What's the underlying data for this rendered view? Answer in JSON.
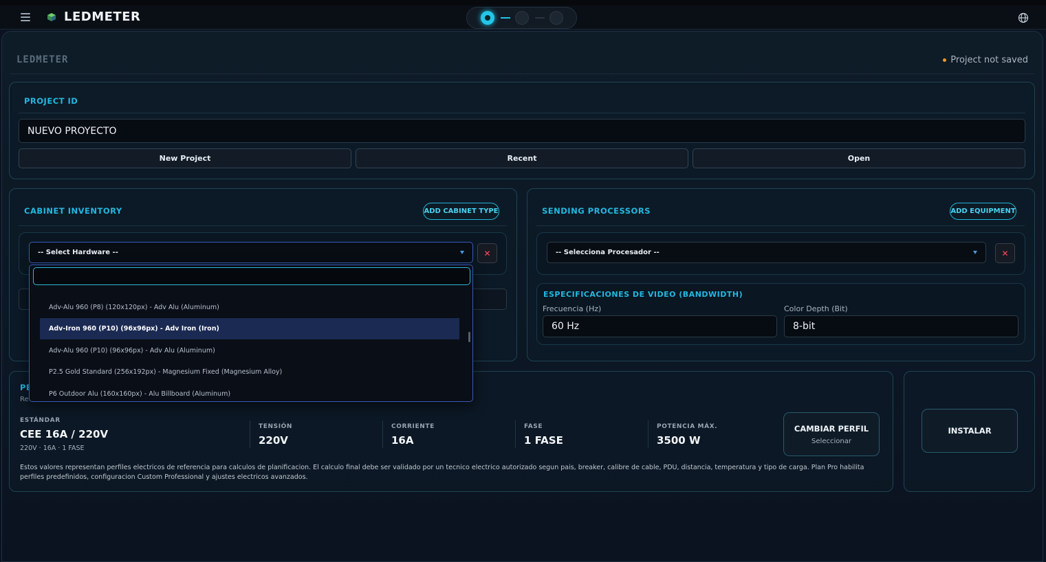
{
  "app": {
    "brand": "LEDMETER",
    "ghost_logo": "LEDMETER",
    "save_status": "Project not saved",
    "accent": "#22c6e8"
  },
  "project": {
    "title": "PROJECT ID",
    "name_value": "NUEVO PROYECTO",
    "buttons": [
      "New Project",
      "Recent",
      "Open"
    ]
  },
  "cabinet": {
    "title": "CABINET INVENTORY",
    "add_label": "ADD CABINET TYPE",
    "select_value": "-- Select Hardware --",
    "remove_label": "✕",
    "dropdown": {
      "search_value": "",
      "items": [
        {
          "label": "Adv-Alu 960 (P8) (120x120px) - Adv Alu (Aluminum)",
          "selected": false
        },
        {
          "label": "Adv-Iron 960 (P10) (96x96px) - Adv Iron (Iron)",
          "selected": true
        },
        {
          "label": "Adv-Alu 960 (P10) (96x96px) - Adv Alu (Aluminum)",
          "selected": false
        },
        {
          "label": "P2.5 Gold Standard (256x192px) - Magnesium Fixed (Magnesium Alloy)",
          "selected": false
        },
        {
          "label": "P6 Outdoor Alu (160x160px) - Alu Billboard (Aluminum)",
          "selected": false
        }
      ]
    }
  },
  "processors": {
    "title": "SENDING PROCESSORS",
    "add_label": "ADD EQUIPMENT",
    "select_value": "-- Selecciona Procesador --",
    "remove_label": "✕",
    "video": {
      "title": "ESPECIFICACIONES DE VIDEO (BANDWIDTH)",
      "freq_label": "Frecuencia (Hz)",
      "freq_value": "60 Hz",
      "depth_label": "Color Depth (Bit)",
      "depth_value": "8-bit"
    }
  },
  "power": {
    "title_partial": "PE",
    "sub_partial": "Re",
    "standard_label": "ESTÁNDAR",
    "standard_value": "CEE 16A / 220V",
    "standard_sub": "220V · 16A · 1 FASE",
    "stats": [
      {
        "label": "TENSIÓN",
        "value": "220V"
      },
      {
        "label": "CORRIENTE",
        "value": "16A"
      },
      {
        "label": "FASE",
        "value": "1 FASE"
      },
      {
        "label": "POTENCIA MÁX.",
        "value": "3500 W"
      }
    ],
    "change_profile_label": "CAMBIAR PERFIL",
    "change_profile_sub": "Seleccionar",
    "disclaimer": "Estos valores representan perfiles electricos de referencia para calculos de planificacion. El calculo final debe ser validado por un tecnico electrico autorizado segun pais, breaker, calibre de cable, PDU, distancia, temperatura y tipo de carga. Plan Pro habilita perfiles predefinidos, configuracion Custom Professional y ajustes electricos avanzados."
  },
  "install": {
    "label": "INSTALAR"
  }
}
